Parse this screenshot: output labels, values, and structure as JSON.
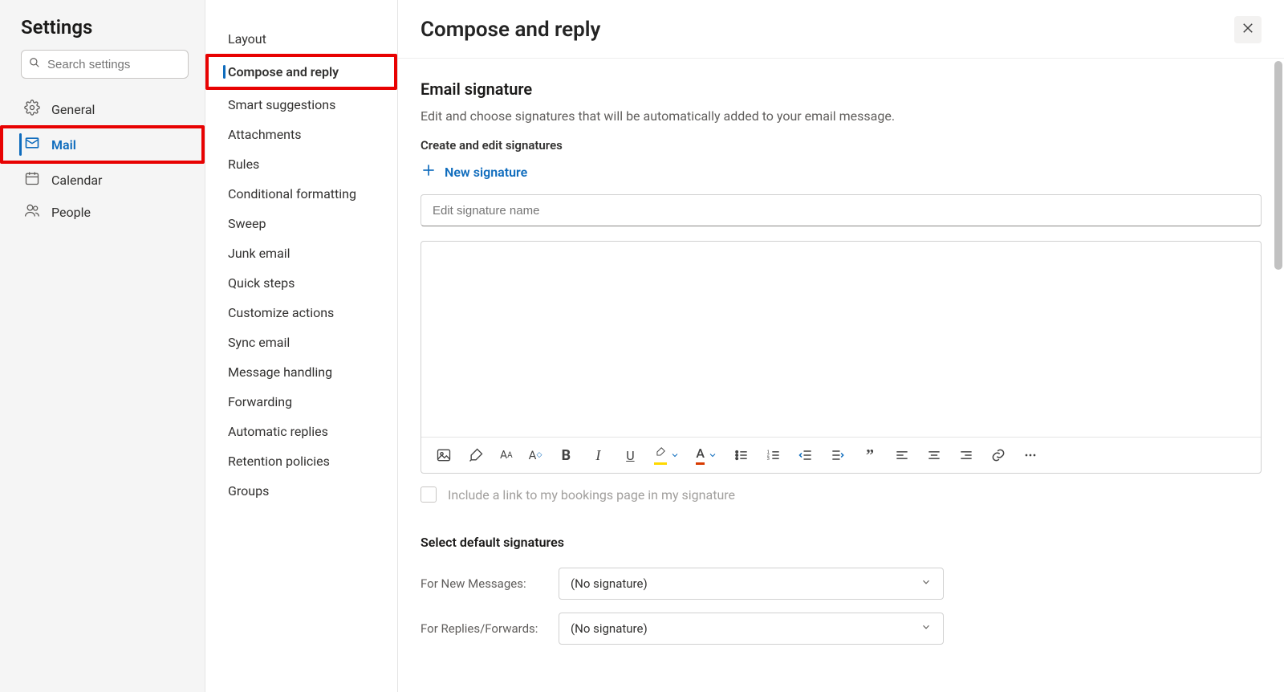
{
  "settings": {
    "title": "Settings",
    "search_placeholder": "Search settings",
    "items": [
      {
        "id": "general",
        "label": "General",
        "active": false
      },
      {
        "id": "mail",
        "label": "Mail",
        "active": true
      },
      {
        "id": "calendar",
        "label": "Calendar",
        "active": false
      },
      {
        "id": "people",
        "label": "People",
        "active": false
      }
    ]
  },
  "midnav": {
    "items": [
      {
        "id": "layout",
        "label": "Layout",
        "active": false
      },
      {
        "id": "compose-reply",
        "label": "Compose and reply",
        "active": true
      },
      {
        "id": "smart-suggestions",
        "label": "Smart suggestions",
        "active": false
      },
      {
        "id": "attachments",
        "label": "Attachments",
        "active": false
      },
      {
        "id": "rules",
        "label": "Rules",
        "active": false
      },
      {
        "id": "conditional-format",
        "label": "Conditional formatting",
        "active": false
      },
      {
        "id": "sweep",
        "label": "Sweep",
        "active": false
      },
      {
        "id": "junk-email",
        "label": "Junk email",
        "active": false
      },
      {
        "id": "quick-steps",
        "label": "Quick steps",
        "active": false
      },
      {
        "id": "customize-actions",
        "label": "Customize actions",
        "active": false
      },
      {
        "id": "sync-email",
        "label": "Sync email",
        "active": false
      },
      {
        "id": "message-handling",
        "label": "Message handling",
        "active": false
      },
      {
        "id": "forwarding",
        "label": "Forwarding",
        "active": false
      },
      {
        "id": "automatic-replies",
        "label": "Automatic replies",
        "active": false
      },
      {
        "id": "retention-policies",
        "label": "Retention policies",
        "active": false
      },
      {
        "id": "groups",
        "label": "Groups",
        "active": false
      }
    ]
  },
  "main": {
    "title": "Compose and reply",
    "signature_heading": "Email signature",
    "signature_desc": "Edit and choose signatures that will be automatically added to your email message.",
    "create_label": "Create and edit signatures",
    "new_sig_label": "New signature",
    "sig_name_placeholder": "Edit signature name",
    "bookings_label": "Include a link to my bookings page in my signature",
    "default_heading": "Select default signatures",
    "for_new_label": "For New Messages:",
    "for_replies_label": "For Replies/Forwards:",
    "no_signature_label": "(No signature)"
  },
  "toolbar_icons": [
    "image-icon",
    "format-painter-icon",
    "font-case-icon",
    "font-size-icon",
    "bold-icon",
    "italic-icon",
    "underline-icon",
    "highlight-color-icon",
    "font-color-icon",
    "bulleted-list-icon",
    "numbered-list-icon",
    "decrease-indent-icon",
    "increase-indent-icon",
    "quote-icon",
    "align-left-icon",
    "align-center-icon",
    "align-right-icon",
    "insert-link-icon",
    "more-options-icon"
  ]
}
